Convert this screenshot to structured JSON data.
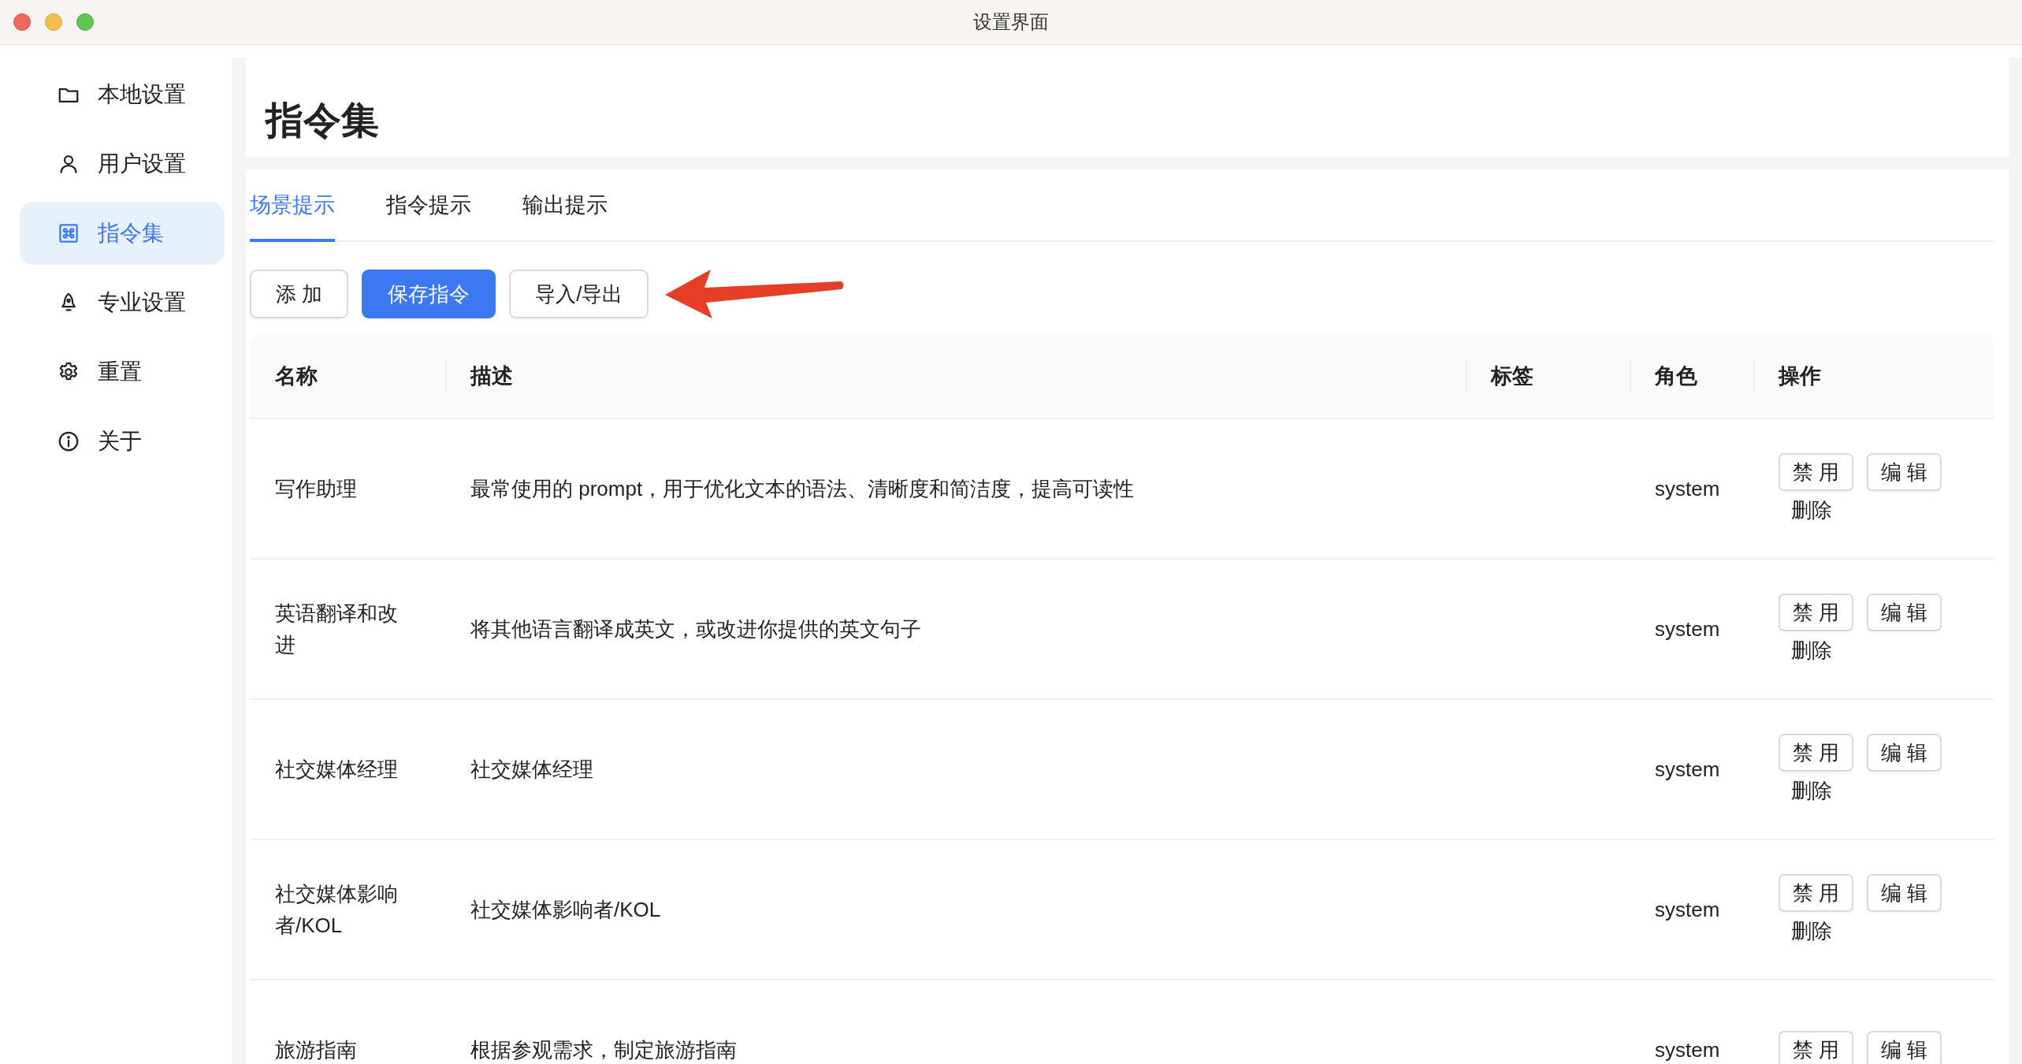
{
  "window": {
    "title": "设置界面"
  },
  "sidebar": {
    "items": [
      {
        "label": "本地设置",
        "selected": false
      },
      {
        "label": "用户设置",
        "selected": false
      },
      {
        "label": "指令集",
        "selected": true
      },
      {
        "label": "专业设置",
        "selected": false
      },
      {
        "label": "重置",
        "selected": false
      },
      {
        "label": "关于",
        "selected": false
      }
    ]
  },
  "page_title": "指令集",
  "tabs": [
    {
      "label": "场景提示",
      "selected": true
    },
    {
      "label": "指令提示",
      "selected": false
    },
    {
      "label": "输出提示",
      "selected": false
    }
  ],
  "toolbar": {
    "buttons": [
      {
        "label": "添 加",
        "kind": "default"
      },
      {
        "label": "保存指令",
        "kind": "primary"
      },
      {
        "label": "导入/导出",
        "kind": "default"
      }
    ]
  },
  "annotations": [
    {
      "kind": "arrow"
    }
  ],
  "table": {
    "columns": [
      "名称",
      "描述",
      "标签",
      "角色",
      "操作"
    ],
    "rows": [
      {
        "name": "写作助理",
        "description": "最常使用的 prompt，用于优化文本的语法、清晰度和简洁度，提高可读性",
        "role": "system",
        "actions": [
          {
            "label": "禁 用",
            "kind": "button"
          },
          {
            "label": "编 辑",
            "kind": "button"
          },
          {
            "label": "删除",
            "kind": "link"
          }
        ]
      },
      {
        "name": "英语翻译和改进",
        "description": "将其他语言翻译成英文，或改进你提供的英文句子",
        "role": "system",
        "actions": [
          {
            "label": "禁 用",
            "kind": "button"
          },
          {
            "label": "编 辑",
            "kind": "button"
          },
          {
            "label": "删除",
            "kind": "link"
          }
        ]
      },
      {
        "name": "社交媒体经理",
        "description": "社交媒体经理",
        "role": "system",
        "actions": [
          {
            "label": "禁 用",
            "kind": "button"
          },
          {
            "label": "编 辑",
            "kind": "button"
          },
          {
            "label": "删除",
            "kind": "link"
          }
        ]
      },
      {
        "name": "社交媒体影响者/KOL",
        "description": "社交媒体影响者/KOL",
        "role": "system",
        "actions": [
          {
            "label": "禁 用",
            "kind": "button"
          },
          {
            "label": "编 辑",
            "kind": "button"
          },
          {
            "label": "删除",
            "kind": "link"
          }
        ]
      },
      {
        "name": "旅游指南",
        "description": "根据参观需求，制定旅游指南",
        "role": "system",
        "actions": [
          {
            "label": "禁 用",
            "kind": "button"
          },
          {
            "label": "编 辑",
            "kind": "button"
          }
        ]
      }
    ]
  }
}
